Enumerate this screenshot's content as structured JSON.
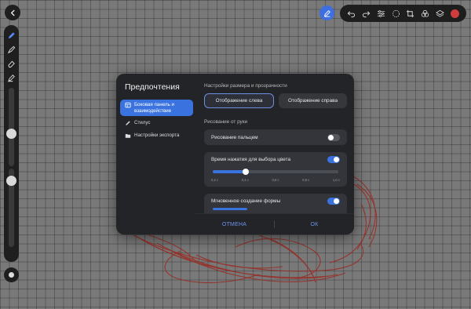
{
  "app": {
    "accent_color": "#3a73e0",
    "grid_color": "#8a8a8a"
  },
  "top_left": {
    "back_icon": "chevron-left-icon"
  },
  "left_toolbar": {
    "tools": [
      "pencil-icon",
      "brush-icon",
      "eraser-icon",
      "marker-icon"
    ],
    "size_slider_level": 0.4,
    "opacity_slider_level": 0.55
  },
  "top_toolbar": {
    "edit_icon": "edit-icon",
    "items": [
      "undo-icon",
      "redo-icon",
      "adjust-icon",
      "lasso-icon",
      "crop-icon",
      "blend-icon",
      "layers-icon"
    ],
    "current_color": "#d13d3d"
  },
  "dialog": {
    "title": "Предпочтения",
    "nav": [
      {
        "label": "Боковая панель и взаимодействие",
        "icon": "sidebar-icon",
        "active": true
      },
      {
        "label": "Стилус",
        "icon": "stylus-icon",
        "active": false
      },
      {
        "label": "Настройки экспорта",
        "icon": "folder-icon",
        "active": false
      }
    ],
    "size_section": {
      "label": "Настройки размера и прозрачности",
      "options": [
        "Отображение слева",
        "Отображение справа"
      ],
      "selected": "Отображение слева"
    },
    "hand_section": {
      "label": "Рисование от руки",
      "finger_drawing": {
        "label": "Рисование пальцем",
        "on": false
      },
      "press_time": {
        "label": "Время нажатия для выбора цвета",
        "on": true,
        "ticks": [
          "0,2 с",
          "0,4 с",
          "0,6 с",
          "0,8 с",
          "1,0 с"
        ],
        "value_fraction": 0.26
      },
      "instant_shape": {
        "label": "Мгновенное создание формы",
        "on": true
      }
    },
    "buttons": {
      "cancel": "ОТМЕНА",
      "ok": "ОК"
    }
  }
}
